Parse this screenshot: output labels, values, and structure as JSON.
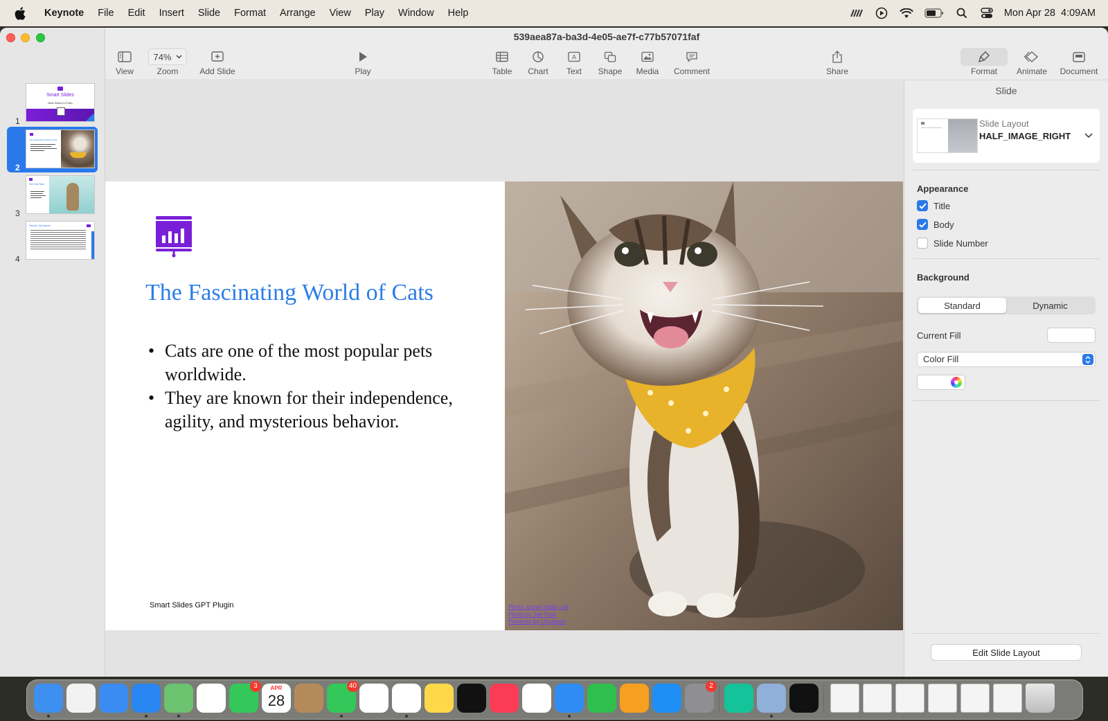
{
  "menubar": {
    "app_name": "Keynote",
    "items": [
      "File",
      "Edit",
      "Insert",
      "Slide",
      "Format",
      "Arrange",
      "View",
      "Play",
      "Window",
      "Help"
    ],
    "clock": "Mon Apr 28  4:09AM"
  },
  "window": {
    "title": "539aea87a-ba3d-4e05-ae7f-c77b57071faf"
  },
  "toolbar": {
    "view_label": "View",
    "zoom_value": "74%",
    "zoom_label": "Zoom",
    "add_slide_label": "Add Slide",
    "play_label": "Play",
    "table_label": "Table",
    "chart_label": "Chart",
    "text_label": "Text",
    "shape_label": "Shape",
    "media_label": "Media",
    "comment_label": "Comment",
    "share_label": "Share",
    "format_label": "Format",
    "animate_label": "Animate",
    "document_label": "Document"
  },
  "navigator": {
    "slides": [
      {
        "number": "1",
        "title": "Smart Slides",
        "subtitle": "Make Slides in a Flash",
        "selected": false
      },
      {
        "number": "2",
        "title": "The Fascinating World of Cats",
        "selected": true
      },
      {
        "number": "3",
        "title": "Fun Cat Facts",
        "selected": false
      },
      {
        "number": "4",
        "title": "Tips for Cat Owners",
        "selected": false
      }
    ]
  },
  "slide": {
    "title": "The Fascinating World of Cats",
    "bullets": [
      "Cats are one of the most popular pets worldwide.",
      "They are known for their independence, agility, and mysterious behavior."
    ],
    "footer": "Smart Slides GPT Plugin",
    "credits": [
      "Photo: brown tabby cat",
      "Photo by Jae Park",
      "Powered by Unsplash"
    ]
  },
  "inspector": {
    "header": "Slide",
    "layout_caption": "Slide Layout",
    "layout_name": "HALF_IMAGE_RIGHT",
    "appearance_label": "Appearance",
    "checks": [
      {
        "label": "Title",
        "checked": true
      },
      {
        "label": "Body",
        "checked": true
      },
      {
        "label": "Slide Number",
        "checked": false
      }
    ],
    "background_label": "Background",
    "bg_options": [
      "Standard",
      "Dynamic"
    ],
    "current_fill_label": "Current Fill",
    "fill_type": "Color Fill",
    "edit_layout_button": "Edit Slide Layout"
  },
  "dock": {
    "apps": [
      {
        "name": "Finder",
        "icon": "finder-icon",
        "color": "#3d8ff0",
        "badge": ""
      },
      {
        "name": "Launchpad",
        "icon": "launchpad-icon",
        "color": "#f2f2f2",
        "badge": ""
      },
      {
        "name": "Mail",
        "icon": "mail-icon",
        "color": "#3a8cf2",
        "badge": ""
      },
      {
        "name": "Safari",
        "icon": "safari-icon",
        "color": "#2a86f0",
        "badge": ""
      },
      {
        "name": "Maps",
        "icon": "maps-icon",
        "color": "#6cc36f",
        "badge": ""
      },
      {
        "name": "Photos",
        "icon": "photos-icon",
        "color": "#ffffff",
        "badge": ""
      },
      {
        "name": "FaceTime",
        "icon": "facetime-icon",
        "color": "#34c759",
        "badge": "3"
      },
      {
        "name": "Calendar",
        "icon": "calendar-icon",
        "color": "#ffffff",
        "badge": "",
        "month": "APR",
        "day": "28"
      },
      {
        "name": "Contacts",
        "icon": "contacts-icon",
        "color": "#b58a5a",
        "badge": ""
      },
      {
        "name": "Messages",
        "icon": "messages-icon",
        "color": "#34c759",
        "badge": "40"
      },
      {
        "name": "Freeform",
        "icon": "freeform-icon",
        "color": "#ffffff",
        "badge": ""
      },
      {
        "name": "Reminders",
        "icon": "reminders-icon",
        "color": "#ffffff",
        "badge": ""
      },
      {
        "name": "Notes",
        "icon": "notes-icon",
        "color": "#ffd84a",
        "badge": ""
      },
      {
        "name": "TV",
        "icon": "tv-icon",
        "color": "#111111",
        "badge": ""
      },
      {
        "name": "Music",
        "icon": "music-icon",
        "color": "#fa3c55",
        "badge": ""
      },
      {
        "name": "News",
        "icon": "news-icon",
        "color": "#ffffff",
        "badge": ""
      },
      {
        "name": "Keynote",
        "icon": "keynote-icon",
        "color": "#2f8cf5",
        "badge": ""
      },
      {
        "name": "Numbers",
        "icon": "numbers-icon",
        "color": "#2fbf4c",
        "badge": ""
      },
      {
        "name": "Pages",
        "icon": "pages-icon",
        "color": "#f6a021",
        "badge": ""
      },
      {
        "name": "App Store",
        "icon": "appstore-icon",
        "color": "#1d8ff5",
        "badge": ""
      },
      {
        "name": "System Settings",
        "icon": "settings-icon",
        "color": "#8e8e93",
        "badge": "2"
      },
      {
        "name": "Grammarly",
        "icon": "grammarly-icon",
        "color": "#15c39a",
        "badge": ""
      },
      {
        "name": "Preview",
        "icon": "preview-icon",
        "color": "#8fb0d8",
        "badge": ""
      },
      {
        "name": "EA",
        "icon": "ea-icon",
        "color": "#111111",
        "badge": ""
      }
    ]
  },
  "colors": {
    "accent": "#2a79ea",
    "slide_title": "#2b7de9",
    "brand_purple": "#7a1fd8"
  }
}
